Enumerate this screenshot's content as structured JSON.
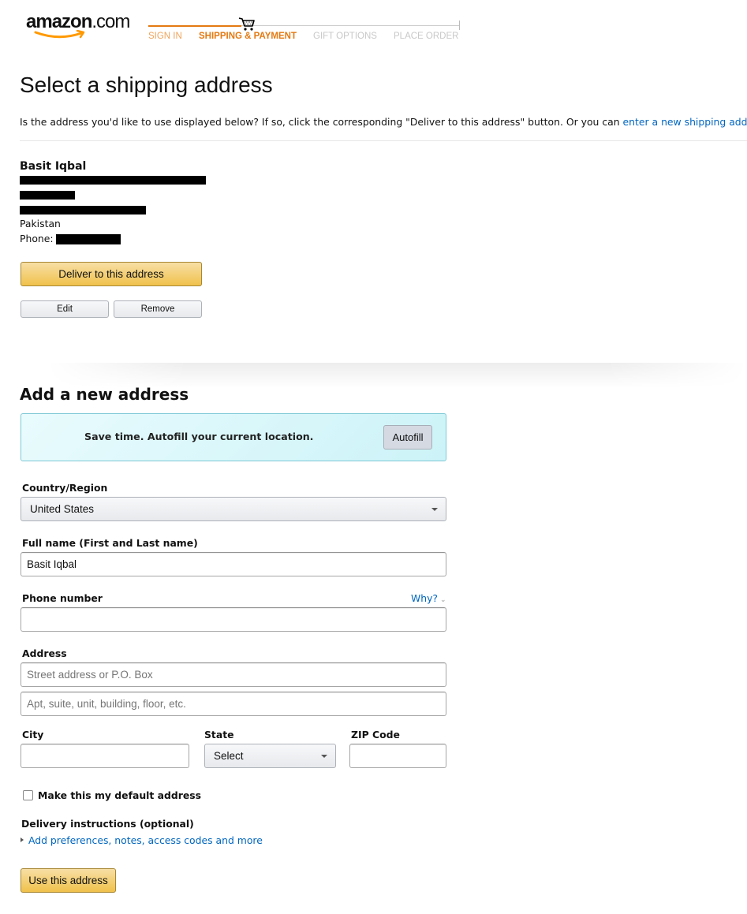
{
  "header": {
    "logo": {
      "main": "amazon",
      "suffix": ".com"
    },
    "checkout_steps": [
      {
        "label": "SIGN IN",
        "state": "done"
      },
      {
        "label": "SHIPPING & PAYMENT",
        "state": "active"
      },
      {
        "label": "GIFT OPTIONS",
        "state": "todo"
      },
      {
        "label": "PLACE ORDER",
        "state": "todo"
      }
    ],
    "progress_icon": "cart-icon",
    "accent_color": "#e47911"
  },
  "shipping": {
    "title": "Select a shipping address",
    "intro_text": "Is the address you'd like to use displayed below? If so, click the corresponding \"Deliver to this address\" button. Or you can ",
    "intro_link": "enter a new shipping address",
    "intro_end": ".",
    "saved_address": {
      "name": "Basit Iqbal",
      "redacted_lines": 3,
      "country": "Pakistan",
      "phone_label": "Phone:",
      "deliver_button": "Deliver to this address",
      "edit_button": "Edit",
      "remove_button": "Remove"
    }
  },
  "new_address": {
    "title": "Add a new address",
    "autofill": {
      "text": "Save time. Autofill your current location.",
      "button": "Autofill"
    },
    "country": {
      "label": "Country/Region",
      "value": "United States"
    },
    "full_name": {
      "label": "Full name (First and Last name)",
      "value": "Basit Iqbal"
    },
    "phone": {
      "label": "Phone number",
      "value": "",
      "why_link": "Why?"
    },
    "address": {
      "label": "Address",
      "line1_placeholder": "Street address or P.O. Box",
      "line2_placeholder": "Apt, suite, unit, building, floor, etc."
    },
    "city": {
      "label": "City",
      "value": ""
    },
    "state": {
      "label": "State",
      "value": "Select"
    },
    "zip": {
      "label": "ZIP Code",
      "value": ""
    },
    "default_checkbox": {
      "label": "Make this my default address",
      "checked": false
    },
    "delivery": {
      "label": "Delivery instructions (optional)",
      "link": "Add preferences, notes, access codes and more"
    },
    "submit_button": "Use this address"
  }
}
